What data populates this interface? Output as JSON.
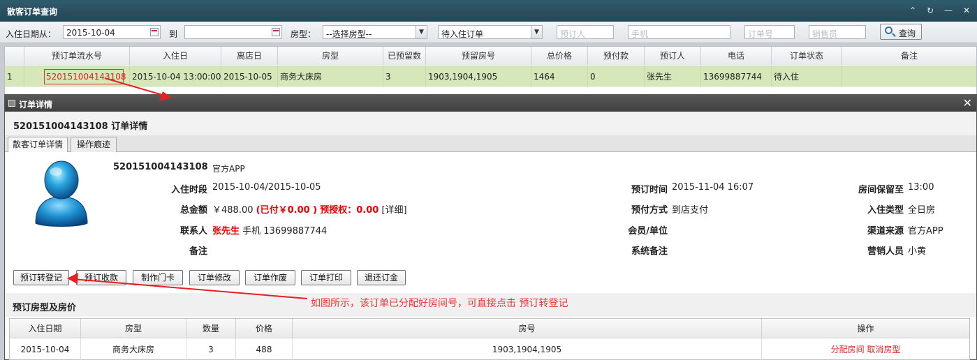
{
  "window": {
    "title": "散客订单查询"
  },
  "search": {
    "checkin_from_label": "入住日期从：",
    "checkin_from_value": "2015-10-04",
    "to_label": "到",
    "to_value": "",
    "room_type_label": "房型：",
    "room_type_value": "--选择房型--",
    "order_status_value": "待入住订单",
    "booker_placeholder": "预订人",
    "phone_placeholder": "手机",
    "order_no_placeholder": "订单号",
    "salesperson_placeholder": "销售员",
    "query_label": "查询"
  },
  "grid": {
    "columns": [
      "",
      "预订单流水号",
      "入住日",
      "离店日",
      "房型",
      "已预留数",
      "预留房号",
      "总价格",
      "预付款",
      "预订人",
      "电话",
      "订单状态",
      "备注"
    ],
    "rows": [
      [
        "1",
        "520151004143108",
        "2015-10-04 13:00:00",
        "2015-10-05",
        "商务大床房",
        "3",
        "1903,1904,1905",
        "1464",
        "0",
        "张先生",
        "13699887744",
        "待入住",
        ""
      ]
    ]
  },
  "detail": {
    "panel_title": "订单详情",
    "heading": "520151004143108 订单详情",
    "tabs": [
      "散客订单详情",
      "操作痕迹"
    ],
    "order_no": "520151004143108",
    "source_text": "官方APP",
    "labels": {
      "stay_period": "入住时段",
      "total": "总金额",
      "contact": "联系人",
      "remark": "备注",
      "booking_time": "预订时间",
      "prepay_method": "预付方式",
      "member_unit": "会员/单位",
      "system_remark": "系统备注",
      "hold_until": "房间保留至",
      "checkin_type": "入住类型",
      "channel": "渠道来源",
      "sales": "营销人员"
    },
    "values": {
      "stay_period": "2015-10-04/2015-10-05",
      "total_amount": "￥488.00",
      "total_paid": "(已付￥0.00 )",
      "total_preauth": "预授权：0.00",
      "total_detail": "[详细]",
      "contact_name": "张先生",
      "contact_phone": "手机 13699887744",
      "remark": "",
      "booking_time": "2015-11-04 16:07",
      "prepay_method": "到店支付",
      "member_unit": "",
      "system_remark": "",
      "hold_until": "13:00",
      "checkin_type": "全日房",
      "channel": "官方APP",
      "sales": "小黄"
    },
    "actions": [
      "预订转登记",
      "预订收款",
      "制作门卡",
      "订单修改",
      "订单作废",
      "订单打印",
      "退还订金"
    ],
    "section_title": "预订房型及房价",
    "annotation": "如图所示，该订单已分配好房间号，可直接点击 预订转登记",
    "room_table": {
      "columns": [
        "入住日期",
        "房型",
        "数量",
        "价格",
        "房号",
        "操作"
      ],
      "rows": [
        {
          "date": "2015-10-04",
          "type": "商务大床房",
          "qty": "3",
          "price": "488",
          "rooms": "1903,1904,1905",
          "op1": "分配房间",
          "op2": "取消房型"
        }
      ]
    }
  },
  "colors": {
    "titlebar": "#2a4f5f",
    "row_selected": "#d6e8b9",
    "accent_red": "#e00000"
  }
}
